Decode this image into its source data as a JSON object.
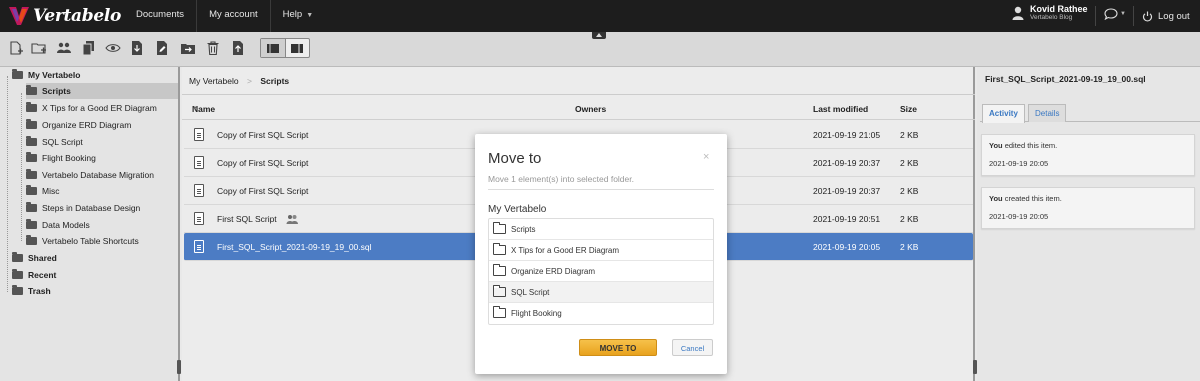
{
  "app": {
    "name": "Vertabelo",
    "accent_color": "#4c7cc4",
    "button_color": "#f0b232"
  },
  "topnav": {
    "items": [
      {
        "label": "Documents"
      },
      {
        "label": "My account"
      },
      {
        "label": "Help"
      }
    ]
  },
  "user": {
    "name": "Kovid Rathee",
    "subtitle": "Vertabelo Blog",
    "logout_label": "Log out"
  },
  "toolbar": {
    "icons": [
      "new-document-icon",
      "new-folder-icon",
      "share-icon",
      "copy-icon",
      "view-icon",
      "download-icon",
      "edit-icon",
      "move-icon",
      "delete-icon",
      "upload-icon"
    ],
    "view_modes": [
      "list-view-icon",
      "detail-view-icon"
    ]
  },
  "sidebar": {
    "root_label": "My Vertabelo",
    "items": [
      {
        "label": "Scripts",
        "selected": true
      },
      {
        "label": "X Tips for a Good ER Diagram"
      },
      {
        "label": "Organize ERD Diagram"
      },
      {
        "label": "SQL Script"
      },
      {
        "label": "Flight Booking"
      },
      {
        "label": "Vertabelo Database Migration"
      },
      {
        "label": "Misc"
      },
      {
        "label": "Steps in Database Design"
      },
      {
        "label": "Data Models"
      },
      {
        "label": "Vertabelo Table Shortcuts"
      }
    ],
    "bottom_items": [
      {
        "label": "Shared"
      },
      {
        "label": "Recent"
      },
      {
        "label": "Trash"
      }
    ]
  },
  "main": {
    "breadcrumb": {
      "root": "My Vertabelo",
      "separator": ">",
      "current": "Scripts"
    },
    "columns": {
      "name": "Name",
      "owners": "Owners",
      "last_modified": "Last modified",
      "size": "Size"
    },
    "rows": [
      {
        "name": "Copy of First SQL Script",
        "last_modified": "2021-09-19 21:05",
        "size": "2 KB"
      },
      {
        "name": "Copy of First SQL Script",
        "last_modified": "2021-09-19 20:37",
        "size": "2 KB"
      },
      {
        "name": "Copy of First SQL Script",
        "last_modified": "2021-09-19 20:37",
        "size": "2 KB"
      },
      {
        "name": "First SQL Script",
        "last_modified": "2021-09-19 20:51",
        "size": "2 KB",
        "shared": true
      },
      {
        "name": "First_SQL_Script_2021-09-19_19_00.sql",
        "last_modified": "2021-09-19 20:05",
        "size": "2 KB",
        "selected": true
      }
    ]
  },
  "right_panel": {
    "title": "First_SQL_Script_2021-09-19_19_00.sql",
    "tabs": [
      {
        "label": "Activity",
        "active": true
      },
      {
        "label": "Details"
      }
    ],
    "activities": [
      {
        "actor": "You",
        "text": "edited this item.",
        "time": "2021-09-19 20:05"
      },
      {
        "actor": "You",
        "text": "created this item.",
        "time": "2021-09-19 20:05"
      }
    ]
  },
  "modal": {
    "title": "Move to",
    "subtitle": "Move 1 element(s) into selected folder.",
    "close_glyph": "×",
    "root_label": "My Vertabelo",
    "folders": [
      {
        "label": "Scripts"
      },
      {
        "label": "X Tips for a Good ER Diagram"
      },
      {
        "label": "Organize ERD Diagram"
      },
      {
        "label": "SQL Script",
        "hovered": true
      },
      {
        "label": "Flight Booking"
      }
    ],
    "move_label": "MOVE TO",
    "cancel_label": "Cancel"
  }
}
